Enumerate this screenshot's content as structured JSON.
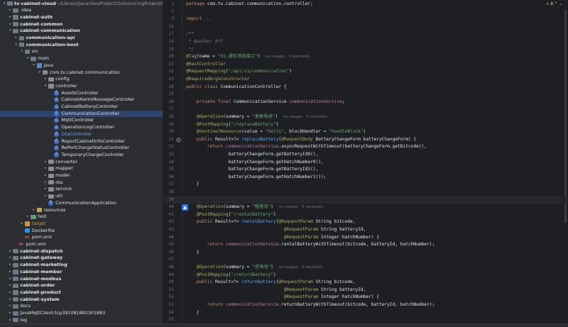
{
  "tree": [
    {
      "label": "tx-cabinet-cloud",
      "suffix": " ~/Library/Java/IdeaProject/OutsourcingProject/tx-cab",
      "indent": 0,
      "arrow": "down",
      "icon": "folder",
      "style": "bold"
    },
    {
      "label": ".idea",
      "indent": 1,
      "arrow": "right",
      "icon": "folder",
      "style": ""
    },
    {
      "label": "cabinet-auth",
      "indent": 1,
      "arrow": "right",
      "icon": "folder",
      "style": "bold"
    },
    {
      "label": "cabinet-common",
      "indent": 1,
      "arrow": "right",
      "icon": "folder",
      "style": "bold"
    },
    {
      "label": "cabinet-communication",
      "indent": 1,
      "arrow": "down",
      "icon": "folder",
      "style": "bold"
    },
    {
      "label": "communication-api",
      "indent": 2,
      "arrow": "right",
      "icon": "folder",
      "style": "bold"
    },
    {
      "label": "communication-boot",
      "indent": 2,
      "arrow": "down",
      "icon": "folder",
      "style": "bold"
    },
    {
      "label": "src",
      "indent": 3,
      "arrow": "down",
      "icon": "folder",
      "style": ""
    },
    {
      "label": "main",
      "indent": 4,
      "arrow": "down",
      "icon": "folder",
      "style": ""
    },
    {
      "label": "java",
      "indent": 5,
      "arrow": "down",
      "icon": "folder-src",
      "style": ""
    },
    {
      "label": "com.tx.cabinet.communication",
      "indent": 6,
      "arrow": "down",
      "icon": "package",
      "style": ""
    },
    {
      "label": "config",
      "indent": 7,
      "arrow": "right",
      "icon": "package",
      "style": ""
    },
    {
      "label": "controller",
      "indent": 7,
      "arrow": "down",
      "icon": "package",
      "style": ""
    },
    {
      "label": "AssetsController",
      "indent": 8,
      "arrow": "",
      "icon": "class",
      "style": ""
    },
    {
      "label": "CabinetAlarmMessageController",
      "indent": 8,
      "arrow": "",
      "icon": "class",
      "style": ""
    },
    {
      "label": "CabinetBatteryController",
      "indent": 8,
      "arrow": "",
      "icon": "class",
      "style": ""
    },
    {
      "label": "CommunicationController",
      "indent": 8,
      "arrow": "",
      "icon": "class",
      "style": "",
      "selected": true
    },
    {
      "label": "MqttController",
      "indent": 8,
      "arrow": "",
      "icon": "class",
      "style": ""
    },
    {
      "label": "OperationLogController",
      "indent": 8,
      "arrow": "",
      "icon": "class",
      "style": ""
    },
    {
      "label": "OtaController",
      "indent": 8,
      "arrow": "",
      "icon": "class",
      "style": "blue"
    },
    {
      "label": "ReportCabinetInfoController",
      "indent": 8,
      "arrow": "",
      "icon": "class",
      "style": ""
    },
    {
      "label": "RePortChargeStatusController",
      "indent": 8,
      "arrow": "",
      "icon": "class",
      "style": ""
    },
    {
      "label": "TemporaryChargeController",
      "indent": 8,
      "arrow": "",
      "icon": "class",
      "style": ""
    },
    {
      "label": "converter",
      "indent": 7,
      "arrow": "right",
      "icon": "package",
      "style": ""
    },
    {
      "label": "mapper",
      "indent": 7,
      "arrow": "right",
      "icon": "package",
      "style": ""
    },
    {
      "label": "model",
      "indent": 7,
      "arrow": "right",
      "icon": "package",
      "style": ""
    },
    {
      "label": "ota",
      "indent": 7,
      "arrow": "right",
      "icon": "package",
      "style": ""
    },
    {
      "label": "service",
      "indent": 7,
      "arrow": "right",
      "icon": "package",
      "style": ""
    },
    {
      "label": "util",
      "indent": 7,
      "arrow": "right",
      "icon": "package",
      "style": ""
    },
    {
      "label": "CommunicationApplication",
      "indent": 7,
      "arrow": "",
      "icon": "class",
      "style": ""
    },
    {
      "label": "resources",
      "indent": 5,
      "arrow": "right",
      "icon": "folder-res",
      "style": ""
    },
    {
      "label": "test",
      "indent": 4,
      "arrow": "right",
      "icon": "folder-test",
      "style": ""
    },
    {
      "label": "target",
      "indent": 3,
      "arrow": "right",
      "icon": "folder-orange",
      "style": "orange"
    },
    {
      "label": "Dockerfile",
      "indent": 3,
      "arrow": "",
      "icon": "docker",
      "style": ""
    },
    {
      "label": "pom.xml",
      "indent": 3,
      "arrow": "",
      "icon": "maven",
      "style": ""
    },
    {
      "label": "pom.xml",
      "indent": 2,
      "arrow": "",
      "icon": "maven",
      "style": ""
    },
    {
      "label": "cabinet-dispatch",
      "indent": 1,
      "arrow": "right",
      "icon": "folder",
      "style": "bold"
    },
    {
      "label": "cabinet-gateway",
      "indent": 1,
      "arrow": "right",
      "icon": "folder",
      "style": "bold"
    },
    {
      "label": "cabinet-marketing",
      "indent": 1,
      "arrow": "right",
      "icon": "folder",
      "style": "bold"
    },
    {
      "label": "cabinet-member",
      "indent": 1,
      "arrow": "right",
      "icon": "folder",
      "style": "bold"
    },
    {
      "label": "cabinet-modbus",
      "indent": 1,
      "arrow": "right",
      "icon": "folder",
      "style": "bold"
    },
    {
      "label": "cabinet-order",
      "indent": 1,
      "arrow": "right",
      "icon": "folder",
      "style": "bold"
    },
    {
      "label": "cabinet-product",
      "indent": 1,
      "arrow": "right",
      "icon": "folder",
      "style": "bold"
    },
    {
      "label": "cabinet-system",
      "indent": 1,
      "arrow": "right",
      "icon": "folder",
      "style": "bold"
    },
    {
      "label": "docs",
      "indent": 1,
      "arrow": "right",
      "icon": "folder",
      "style": ""
    },
    {
      "label": "JavaMqttClient-tcp391081882301883",
      "indent": 1,
      "arrow": "right",
      "icon": "folder",
      "style": ""
    },
    {
      "label": "log",
      "indent": 1,
      "arrow": "right",
      "icon": "folder",
      "style": ""
    }
  ],
  "inspections": {
    "warnings": "8",
    "ok": "✓"
  },
  "editor": {
    "lines": [
      {
        "n": "1",
        "parts": [
          [
            "kw",
            "package "
          ],
          [
            "",
            "com.tx.cabinet.communication.controller;"
          ]
        ]
      },
      {
        "n": "2",
        "parts": []
      },
      {
        "n": "3",
        "parts": [
          [
            "kw",
            "import "
          ],
          [
            "fold",
            "..."
          ]
        ],
        "fold": true
      },
      {
        "n": "16",
        "parts": []
      },
      {
        "n": "17",
        "parts": [
          [
            "cm",
            "/**"
          ]
        ]
      },
      {
        "n": "18",
        "parts": [
          [
            "cm",
            " * @author kcf"
          ]
        ]
      },
      {
        "n": "19",
        "parts": [
          [
            "cm",
            " */"
          ]
        ]
      },
      {
        "n": "20",
        "parts": [
          [
            "an",
            "@Tag"
          ],
          [
            "",
            "(name = "
          ],
          [
            "str",
            "\"02.通信消息接口\""
          ],
          [
            "",
            ")  "
          ],
          [
            "usg",
            "no usages   ⚲ kechaofu"
          ]
        ]
      },
      {
        "n": "21",
        "parts": [
          [
            "an",
            "@RestController"
          ]
        ]
      },
      {
        "n": "22",
        "parts": [
          [
            "an",
            "@RequestMapping"
          ],
          [
            "",
            "("
          ],
          [
            "str",
            "\"/api/v1/communication\""
          ],
          [
            "",
            ")"
          ]
        ]
      },
      {
        "n": "23",
        "parts": [
          [
            "an",
            "@RequiredArgsConstructor"
          ]
        ]
      },
      {
        "n": "24",
        "parts": [
          [
            "kw",
            "public class "
          ],
          [
            "",
            "CommunicationController {"
          ]
        ]
      },
      {
        "n": "25",
        "parts": []
      },
      {
        "n": "26",
        "parts": [
          [
            "kw",
            "    private final "
          ],
          [
            "",
            "CommunicationService "
          ],
          [
            "fld",
            "communicationService"
          ],
          [
            "",
            ";"
          ]
        ]
      },
      {
        "n": "27",
        "parts": []
      },
      {
        "n": "28",
        "parts": [
          [
            "an",
            "    @Operation"
          ],
          [
            "",
            "(summary = "
          ],
          [
            "str",
            "\"更换电池\""
          ],
          [
            "",
            ")  "
          ],
          [
            "usg",
            "no usages   ⚲ kechaofu"
          ]
        ]
      },
      {
        "n": "29",
        "parts": [
          [
            "an",
            "    @PostMapping"
          ],
          [
            "",
            "("
          ],
          [
            "str",
            "\"/replaceBattery\""
          ],
          [
            "",
            ")"
          ]
        ]
      },
      {
        "n": "30",
        "parts": [
          [
            "an",
            "    @SentinelResource"
          ],
          [
            "",
            "(value = "
          ],
          [
            "str",
            "\"hello\""
          ],
          [
            "",
            ", blockHandler = "
          ],
          [
            "str",
            "\"handleBlock\""
          ],
          [
            "",
            ")"
          ]
        ]
      },
      {
        "n": "31",
        "parts": [
          [
            "kw",
            "    public "
          ],
          [
            "",
            "Result<?> "
          ],
          [
            "mth",
            "replaceBattery"
          ],
          [
            "",
            "("
          ],
          [
            "an",
            "@RequestBody "
          ],
          [
            "",
            "BatteryChangeForm batteryChangeForm) {"
          ]
        ],
        "gutter": "override"
      },
      {
        "n": "32",
        "parts": [
          [
            "kw",
            "        return "
          ],
          [
            "fld",
            "communicationService"
          ],
          [
            "",
            ".asyncRequestWithTimeout(batteryChangeForm.getBitcode(),"
          ]
        ]
      },
      {
        "n": "33",
        "parts": [
          [
            "",
            "                batteryChangeForm.getBatteryId0(),"
          ]
        ]
      },
      {
        "n": "34",
        "parts": [
          [
            "",
            "                batteryChangeForm.getHatchNumber0(),"
          ]
        ]
      },
      {
        "n": "35",
        "parts": [
          [
            "",
            "                batteryChangeForm.getBatteryId1(),"
          ]
        ]
      },
      {
        "n": "36",
        "parts": [
          [
            "",
            "                batteryChangeForm.getHatchNumber1());"
          ]
        ]
      },
      {
        "n": "37",
        "parts": [
          [
            "",
            "    }"
          ]
        ]
      },
      {
        "n": "38",
        "parts": []
      },
      {
        "n": "39",
        "parts": [],
        "current": true
      },
      {
        "n": "40",
        "parts": [
          [
            "an",
            "    @Operation"
          ],
          [
            "",
            "(summary = "
          ],
          [
            "str",
            "\"租电池\""
          ],
          [
            "",
            ")  "
          ],
          [
            "usg",
            "no usages   ⚲ kechaofu"
          ]
        ],
        "gutter": "ai"
      },
      {
        "n": "41",
        "parts": [
          [
            "an",
            "    @PostMapping"
          ],
          [
            "",
            "("
          ],
          [
            "str",
            "\"/rentalBattery\""
          ],
          [
            "",
            ")"
          ]
        ]
      },
      {
        "n": "42",
        "parts": [
          [
            "kw",
            "    public "
          ],
          [
            "",
            "Result<?> "
          ],
          [
            "mth",
            "rentalBattery"
          ],
          [
            "",
            "("
          ],
          [
            "an",
            "@RequestParam "
          ],
          [
            "",
            "String bitcode,"
          ]
        ]
      },
      {
        "n": "43",
        "parts": [
          [
            "",
            "                                     "
          ],
          [
            "an",
            "@RequestParam "
          ],
          [
            "",
            "String batteryId,"
          ]
        ]
      },
      {
        "n": "44",
        "parts": [
          [
            "",
            "                                     "
          ],
          [
            "an",
            "@RequestParam "
          ],
          [
            "",
            "Integer hatchNumber) {"
          ]
        ]
      },
      {
        "n": "45",
        "parts": [
          [
            "kw",
            "        return "
          ],
          [
            "fld",
            "communicationService"
          ],
          [
            "",
            ".rentalBatteryWithTimeout(bitcode, batteryId, hatchNumber);"
          ]
        ]
      },
      {
        "n": "46",
        "parts": [
          [
            "",
            "    }"
          ]
        ]
      },
      {
        "n": "47",
        "parts": []
      },
      {
        "n": "48",
        "parts": [
          [
            "an",
            "    @Operation"
          ],
          [
            "",
            "(summary = "
          ],
          [
            "str",
            "\"还电池\""
          ],
          [
            "",
            ")  "
          ],
          [
            "usg",
            "no usages   ⚲ kechaofu"
          ]
        ]
      },
      {
        "n": "49",
        "parts": [
          [
            "an",
            "    @PostMapping"
          ],
          [
            "",
            "("
          ],
          [
            "str",
            "\"/returnBattery\""
          ],
          [
            "",
            ")"
          ]
        ]
      },
      {
        "n": "50",
        "parts": [
          [
            "kw",
            "    public "
          ],
          [
            "",
            "Result<?> "
          ],
          [
            "mth",
            "returnBattery"
          ],
          [
            "",
            "("
          ],
          [
            "an",
            "@RequestParam "
          ],
          [
            "",
            "String bitcode,"
          ]
        ]
      },
      {
        "n": "51",
        "parts": [
          [
            "",
            "                                     "
          ],
          [
            "an",
            "@RequestParam "
          ],
          [
            "",
            "String batteryId,"
          ]
        ]
      },
      {
        "n": "52",
        "parts": [
          [
            "",
            "                                     "
          ],
          [
            "an",
            "@RequestParam "
          ],
          [
            "",
            "Integer hatchNumber) {"
          ]
        ]
      },
      {
        "n": "53",
        "parts": [
          [
            "kw",
            "        return "
          ],
          [
            "fld",
            "communicationService"
          ],
          [
            "",
            ".returnBatteryWithTimeout(bitcode, batteryId, hatchNumber);"
          ]
        ]
      },
      {
        "n": "54",
        "parts": [
          [
            "",
            "    }"
          ]
        ]
      },
      {
        "n": "55",
        "parts": []
      }
    ]
  }
}
